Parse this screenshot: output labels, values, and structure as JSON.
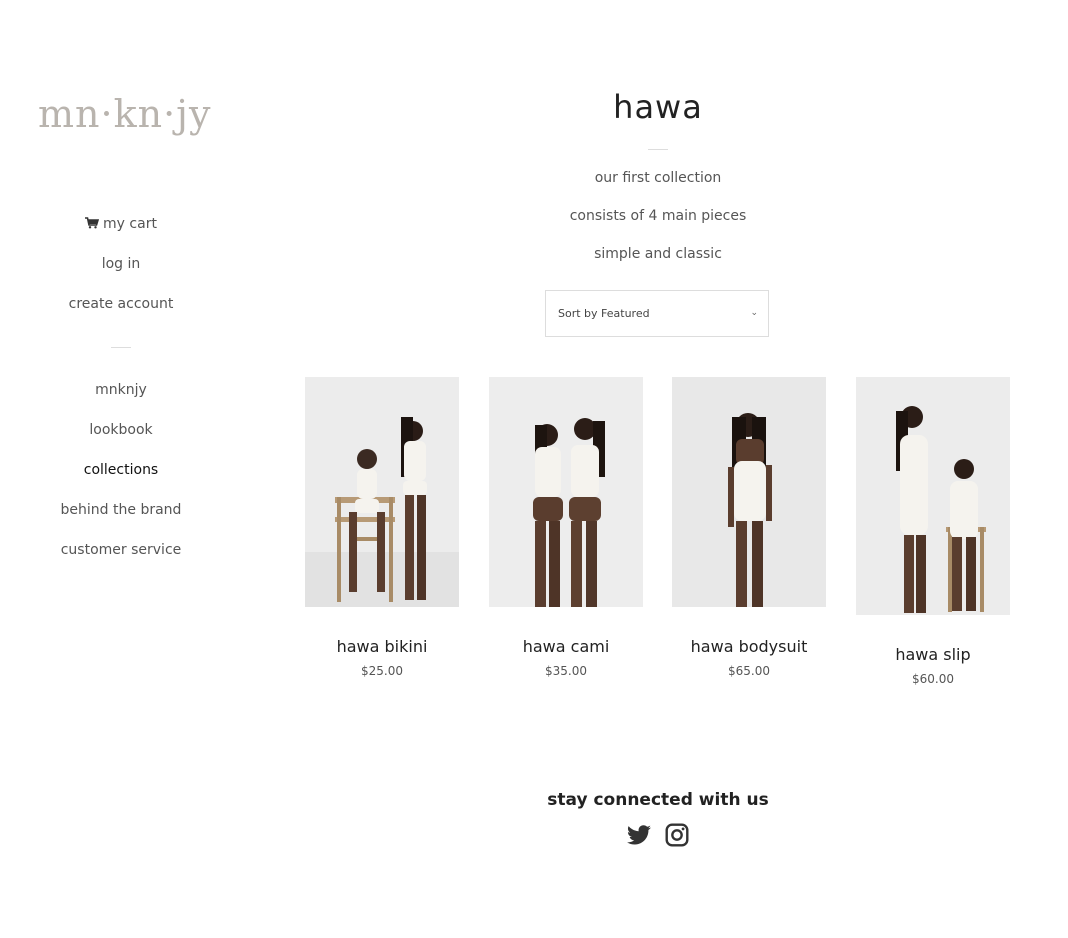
{
  "logo": {
    "text": "mn·kn·jy"
  },
  "sidebar": {
    "account": [
      {
        "label": "my cart",
        "icon": "cart-icon"
      },
      {
        "label": "log in"
      },
      {
        "label": "create account"
      }
    ],
    "nav": [
      {
        "label": "mnknjy"
      },
      {
        "label": "lookbook"
      },
      {
        "label": "collections",
        "active": true
      },
      {
        "label": "behind the brand"
      },
      {
        "label": "customer service"
      }
    ]
  },
  "collection": {
    "title": "hawa",
    "description": [
      "our first collection",
      "consists of 4 main pieces",
      "simple and classic"
    ],
    "sort": {
      "selected": "Sort by Featured"
    }
  },
  "products": [
    {
      "name": "hawa bikini",
      "price": "$25.00"
    },
    {
      "name": "hawa cami",
      "price": "$35.00"
    },
    {
      "name": "hawa bodysuit",
      "price": "$65.00"
    },
    {
      "name": "hawa slip",
      "price": "$60.00"
    }
  ],
  "footer": {
    "title": "stay connected with us",
    "social": [
      {
        "icon": "twitter-icon"
      },
      {
        "icon": "instagram-icon"
      }
    ]
  }
}
